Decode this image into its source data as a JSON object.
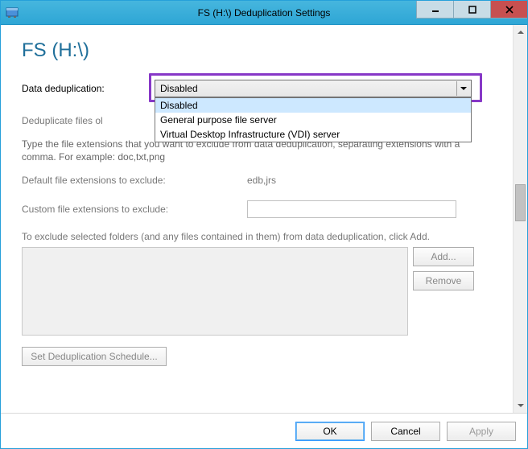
{
  "window": {
    "title": "FS (H:\\) Deduplication Settings"
  },
  "page": {
    "heading": "FS (H:\\)"
  },
  "dedup": {
    "label": "Data deduplication:",
    "selected": "Disabled",
    "options": {
      "o0": "Disabled",
      "o1": "General purpose file server",
      "o2": "Virtual Desktop Infrastructure (VDI) server"
    }
  },
  "texts": {
    "older_than_partial": "Deduplicate files ol",
    "exclude_help": "Type the file extensions that you want to exclude from data deduplication, separating extensions with a comma. For example: doc,txt,png",
    "default_ext_label": "Default file extensions to exclude:",
    "default_ext_value": "edb,jrs",
    "custom_ext_label": "Custom file extensions to exclude:",
    "exclude_folders_caption": "To exclude selected folders (and any files contained in them) from data deduplication, click Add."
  },
  "buttons": {
    "add": "Add...",
    "remove": "Remove",
    "schedule": "Set Deduplication Schedule...",
    "ok": "OK",
    "cancel": "Cancel",
    "apply": "Apply"
  }
}
